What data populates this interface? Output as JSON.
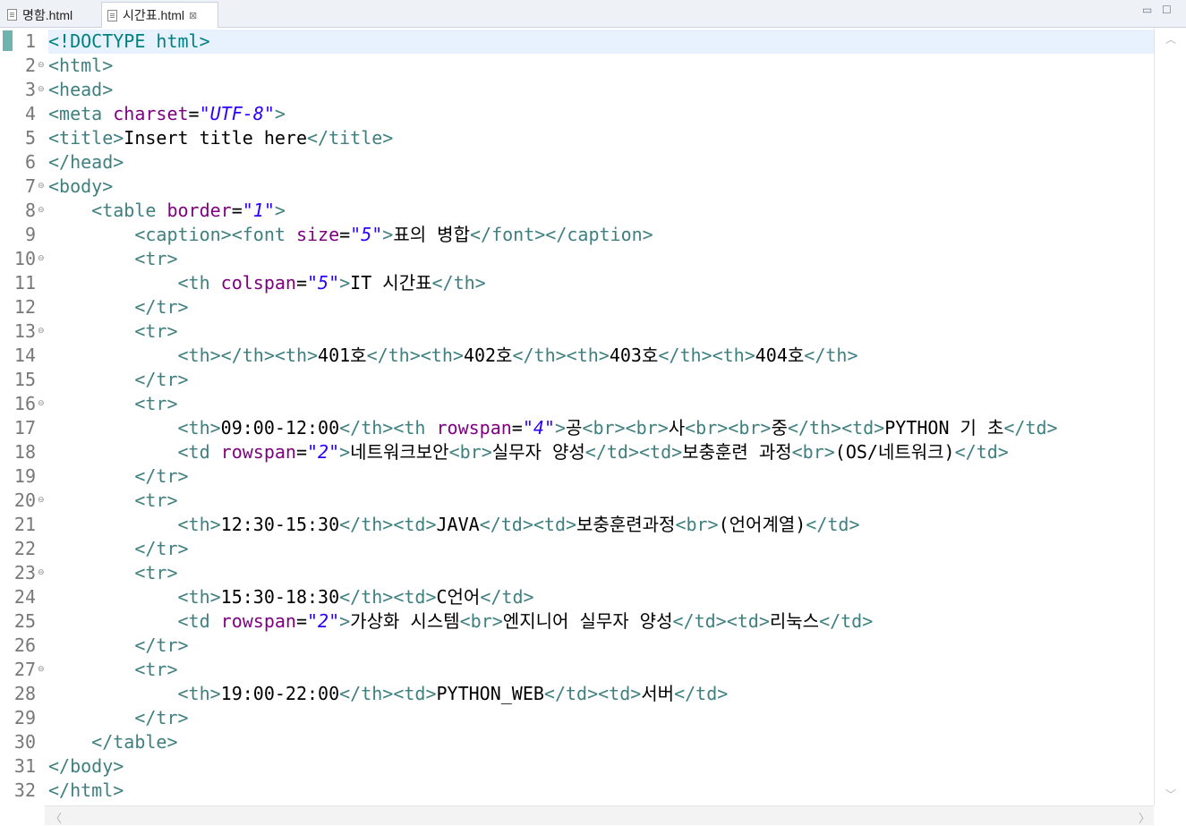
{
  "tabs": [
    {
      "label": "명함.html",
      "active": false
    },
    {
      "label": "시간표.html",
      "active": true
    }
  ],
  "line_numbers": [
    "1",
    "2",
    "3",
    "4",
    "5",
    "6",
    "7",
    "8",
    "9",
    "10",
    "11",
    "12",
    "13",
    "14",
    "15",
    "16",
    "17",
    "18",
    "19",
    "20",
    "21",
    "22",
    "23",
    "24",
    "25",
    "26",
    "27",
    "28",
    "29",
    "30",
    "31",
    "32"
  ],
  "fold_lines": [
    2,
    3,
    7,
    8,
    10,
    13,
    16,
    20,
    23,
    27
  ],
  "colors": {
    "tag": "#3f7f7f",
    "attribute": "#7f007f",
    "value": "#2a00ff",
    "doctype": "#008080",
    "current_line": "#e8f2fe"
  },
  "code": [
    [
      [
        "<!DOCTYPE html>",
        "dt"
      ]
    ],
    [
      [
        "<html>",
        "t"
      ]
    ],
    [
      [
        "<head>",
        "t"
      ]
    ],
    [
      [
        "<meta ",
        "t"
      ],
      [
        "charset",
        "a"
      ],
      [
        "=",
        ""
      ],
      [
        "\"UTF-8\"",
        "v"
      ],
      [
        ">",
        "t"
      ]
    ],
    [
      [
        "<title>",
        "t"
      ],
      [
        "Insert title here",
        ""
      ],
      [
        "</title>",
        "t"
      ]
    ],
    [
      [
        "</head>",
        "t"
      ]
    ],
    [
      [
        "<body>",
        "t"
      ]
    ],
    [
      [
        "    <table ",
        "t"
      ],
      [
        "border",
        "a"
      ],
      [
        "=",
        ""
      ],
      [
        "\"1\"",
        "v"
      ],
      [
        ">",
        "t"
      ]
    ],
    [
      [
        "        <caption><font ",
        "t"
      ],
      [
        "size",
        "a"
      ],
      [
        "=",
        ""
      ],
      [
        "\"5\"",
        "v"
      ],
      [
        ">",
        "t"
      ],
      [
        "표의 병합",
        ""
      ],
      [
        "</font></caption>",
        "t"
      ]
    ],
    [
      [
        "        <tr>",
        "t"
      ]
    ],
    [
      [
        "            <th ",
        "t"
      ],
      [
        "colspan",
        "a"
      ],
      [
        "=",
        ""
      ],
      [
        "\"5\"",
        "v"
      ],
      [
        ">",
        "t"
      ],
      [
        "IT 시간표",
        ""
      ],
      [
        "</th>",
        "t"
      ]
    ],
    [
      [
        "        </tr>",
        "t"
      ]
    ],
    [
      [
        "        <tr>",
        "t"
      ]
    ],
    [
      [
        "            <th></th><th>",
        "t"
      ],
      [
        "401호",
        ""
      ],
      [
        "</th><th>",
        "t"
      ],
      [
        "402호",
        ""
      ],
      [
        "</th><th>",
        "t"
      ],
      [
        "403호",
        ""
      ],
      [
        "</th><th>",
        "t"
      ],
      [
        "404호",
        ""
      ],
      [
        "</th>",
        "t"
      ]
    ],
    [
      [
        "        </tr>",
        "t"
      ]
    ],
    [
      [
        "        <tr>",
        "t"
      ]
    ],
    [
      [
        "            <th>",
        "t"
      ],
      [
        "09:00-12:00",
        ""
      ],
      [
        "</th><th ",
        "t"
      ],
      [
        "rowspan",
        "a"
      ],
      [
        "=",
        ""
      ],
      [
        "\"4\"",
        "v"
      ],
      [
        ">",
        "t"
      ],
      [
        "공",
        ""
      ],
      [
        "<br><br>",
        "t"
      ],
      [
        "사",
        ""
      ],
      [
        "<br><br>",
        "t"
      ],
      [
        "중",
        ""
      ],
      [
        "</th><td>",
        "t"
      ],
      [
        "PYTHON 기 초",
        ""
      ],
      [
        "</td>",
        "t"
      ]
    ],
    [
      [
        "            <td ",
        "t"
      ],
      [
        "rowspan",
        "a"
      ],
      [
        "=",
        ""
      ],
      [
        "\"2\"",
        "v"
      ],
      [
        ">",
        "t"
      ],
      [
        "네트워크보안",
        ""
      ],
      [
        "<br>",
        "t"
      ],
      [
        "실무자 양성",
        ""
      ],
      [
        "</td><td>",
        "t"
      ],
      [
        "보충훈련 과정",
        ""
      ],
      [
        "<br>",
        "t"
      ],
      [
        "(OS/네트워크)",
        ""
      ],
      [
        "</td>",
        "t"
      ]
    ],
    [
      [
        "        </tr>",
        "t"
      ]
    ],
    [
      [
        "        <tr>",
        "t"
      ]
    ],
    [
      [
        "            <th>",
        "t"
      ],
      [
        "12:30-15:30",
        ""
      ],
      [
        "</th><td>",
        "t"
      ],
      [
        "JAVA",
        ""
      ],
      [
        "</td><td>",
        "t"
      ],
      [
        "보충훈련과정",
        ""
      ],
      [
        "<br>",
        "t"
      ],
      [
        "(언어계열)",
        ""
      ],
      [
        "</td>",
        "t"
      ]
    ],
    [
      [
        "        </tr>",
        "t"
      ]
    ],
    [
      [
        "        <tr>",
        "t"
      ]
    ],
    [
      [
        "            <th>",
        "t"
      ],
      [
        "15:30-18:30",
        ""
      ],
      [
        "</th><td>",
        "t"
      ],
      [
        "C언어",
        ""
      ],
      [
        "</td>",
        "t"
      ]
    ],
    [
      [
        "            <td ",
        "t"
      ],
      [
        "rowspan",
        "a"
      ],
      [
        "=",
        ""
      ],
      [
        "\"2\"",
        "v"
      ],
      [
        ">",
        "t"
      ],
      [
        "가상화 시스템",
        ""
      ],
      [
        "<br>",
        "t"
      ],
      [
        "엔지니어 실무자 양성",
        ""
      ],
      [
        "</td><td>",
        "t"
      ],
      [
        "리눅스",
        ""
      ],
      [
        "</td>",
        "t"
      ]
    ],
    [
      [
        "        </tr>",
        "t"
      ]
    ],
    [
      [
        "        <tr>",
        "t"
      ]
    ],
    [
      [
        "            <th>",
        "t"
      ],
      [
        "19:00-22:00",
        ""
      ],
      [
        "</th><td>",
        "t"
      ],
      [
        "PYTHON_WEB",
        ""
      ],
      [
        "</td><td>",
        "t"
      ],
      [
        "서버",
        ""
      ],
      [
        "</td>",
        "t"
      ]
    ],
    [
      [
        "        </tr>",
        "t"
      ]
    ],
    [
      [
        "    </table>",
        "t"
      ]
    ],
    [
      [
        "</body>",
        "t"
      ]
    ],
    [
      [
        "</html>",
        "t"
      ]
    ]
  ]
}
